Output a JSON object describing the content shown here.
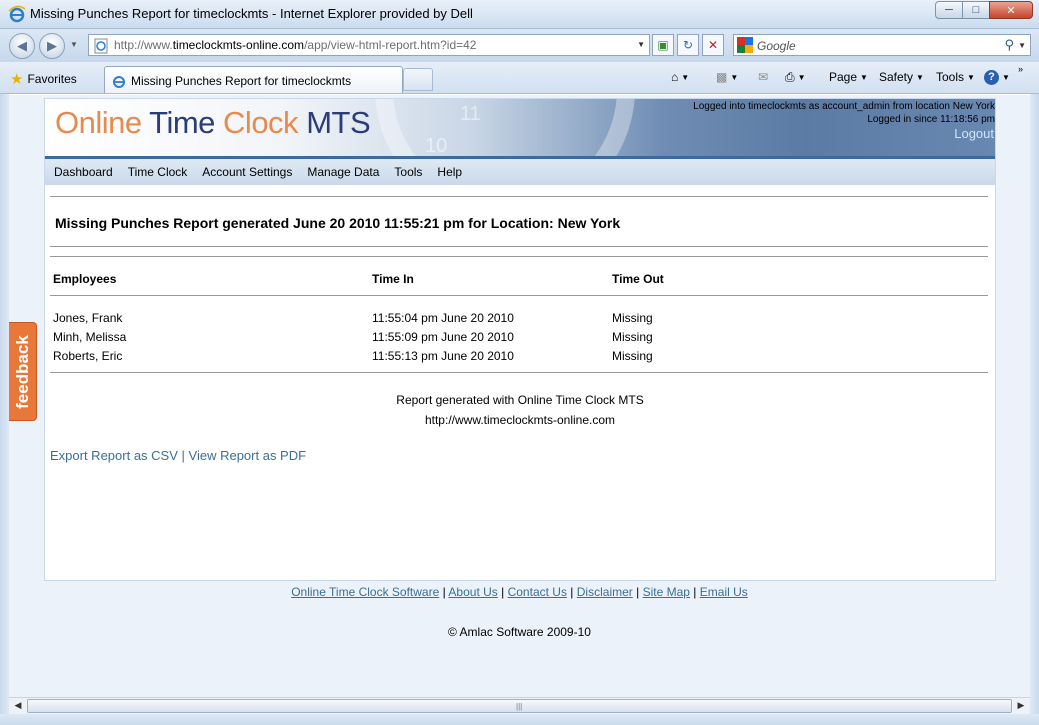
{
  "window": {
    "title": "Missing Punches Report for timeclockmts - Internet Explorer provided by Dell",
    "min_icon": "minimize-icon",
    "max_icon": "maximize-icon",
    "close_icon": "close-icon"
  },
  "address": {
    "url_prefix": "http://www.",
    "url_domain": "timeclockmts-online.com",
    "url_path": "/app/view-html-report.htm?id=42",
    "search_placeholder": "Google"
  },
  "tabs": {
    "favorites_label": "Favorites",
    "active_tab_label": "Missing Punches Report for timeclockmts"
  },
  "commandbar": {
    "page_label": "Page",
    "safety_label": "Safety",
    "tools_label": "Tools"
  },
  "site": {
    "logo": {
      "w1": "Online",
      "w2": "Time",
      "w3": "Clock",
      "w4": "MTS"
    },
    "login_line1": "Logged into timeclockmts as account_admin from location New York",
    "login_line2": "Logged in since 11:18:56 pm",
    "logout_label": "Logout",
    "menu": [
      "Dashboard",
      "Time Clock",
      "Account Settings",
      "Manage Data",
      "Tools",
      "Help"
    ]
  },
  "report": {
    "title": "Missing Punches Report generated June 20 2010 11:55:21 pm for Location: New York",
    "columns": [
      "Employees",
      "Time In",
      "Time Out"
    ],
    "rows": [
      {
        "employee": "Jones, Frank",
        "time_in": "11:55:04 pm June 20 2010",
        "time_out": "Missing"
      },
      {
        "employee": "Minh, Melissa",
        "time_in": "11:55:09 pm June 20 2010",
        "time_out": "Missing"
      },
      {
        "employee": "Roberts, Eric",
        "time_in": "11:55:13 pm June 20 2010",
        "time_out": "Missing"
      }
    ],
    "generated_with": "Report generated with Online Time Clock MTS",
    "generated_url": "http://www.timeclockmts-online.com",
    "export_csv": "Export Report as CSV",
    "export_sep": "|",
    "export_pdf": "View Report as PDF"
  },
  "footer": {
    "links": [
      "Online Time Clock Software",
      "About Us",
      "Contact Us",
      "Disclaimer",
      "Site Map",
      "Email Us"
    ],
    "separator": "|",
    "copyright": "© Amlac Software 2009-10"
  },
  "feedback_label": "feedback",
  "banner_clock": {
    "n11": "11",
    "n10": "10"
  }
}
